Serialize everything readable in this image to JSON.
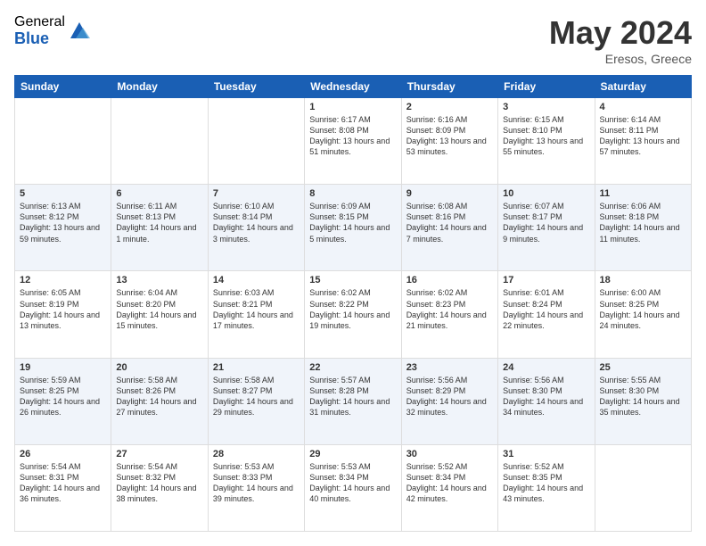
{
  "logo": {
    "general": "General",
    "blue": "Blue"
  },
  "title": "May 2024",
  "location": "Eresos, Greece",
  "headers": [
    "Sunday",
    "Monday",
    "Tuesday",
    "Wednesday",
    "Thursday",
    "Friday",
    "Saturday"
  ],
  "weeks": [
    [
      {
        "day": "",
        "sunrise": "",
        "sunset": "",
        "daylight": ""
      },
      {
        "day": "",
        "sunrise": "",
        "sunset": "",
        "daylight": ""
      },
      {
        "day": "",
        "sunrise": "",
        "sunset": "",
        "daylight": ""
      },
      {
        "day": "1",
        "sunrise": "Sunrise: 6:17 AM",
        "sunset": "Sunset: 8:08 PM",
        "daylight": "Daylight: 13 hours and 51 minutes."
      },
      {
        "day": "2",
        "sunrise": "Sunrise: 6:16 AM",
        "sunset": "Sunset: 8:09 PM",
        "daylight": "Daylight: 13 hours and 53 minutes."
      },
      {
        "day": "3",
        "sunrise": "Sunrise: 6:15 AM",
        "sunset": "Sunset: 8:10 PM",
        "daylight": "Daylight: 13 hours and 55 minutes."
      },
      {
        "day": "4",
        "sunrise": "Sunrise: 6:14 AM",
        "sunset": "Sunset: 8:11 PM",
        "daylight": "Daylight: 13 hours and 57 minutes."
      }
    ],
    [
      {
        "day": "5",
        "sunrise": "Sunrise: 6:13 AM",
        "sunset": "Sunset: 8:12 PM",
        "daylight": "Daylight: 13 hours and 59 minutes."
      },
      {
        "day": "6",
        "sunrise": "Sunrise: 6:11 AM",
        "sunset": "Sunset: 8:13 PM",
        "daylight": "Daylight: 14 hours and 1 minute."
      },
      {
        "day": "7",
        "sunrise": "Sunrise: 6:10 AM",
        "sunset": "Sunset: 8:14 PM",
        "daylight": "Daylight: 14 hours and 3 minutes."
      },
      {
        "day": "8",
        "sunrise": "Sunrise: 6:09 AM",
        "sunset": "Sunset: 8:15 PM",
        "daylight": "Daylight: 14 hours and 5 minutes."
      },
      {
        "day": "9",
        "sunrise": "Sunrise: 6:08 AM",
        "sunset": "Sunset: 8:16 PM",
        "daylight": "Daylight: 14 hours and 7 minutes."
      },
      {
        "day": "10",
        "sunrise": "Sunrise: 6:07 AM",
        "sunset": "Sunset: 8:17 PM",
        "daylight": "Daylight: 14 hours and 9 minutes."
      },
      {
        "day": "11",
        "sunrise": "Sunrise: 6:06 AM",
        "sunset": "Sunset: 8:18 PM",
        "daylight": "Daylight: 14 hours and 11 minutes."
      }
    ],
    [
      {
        "day": "12",
        "sunrise": "Sunrise: 6:05 AM",
        "sunset": "Sunset: 8:19 PM",
        "daylight": "Daylight: 14 hours and 13 minutes."
      },
      {
        "day": "13",
        "sunrise": "Sunrise: 6:04 AM",
        "sunset": "Sunset: 8:20 PM",
        "daylight": "Daylight: 14 hours and 15 minutes."
      },
      {
        "day": "14",
        "sunrise": "Sunrise: 6:03 AM",
        "sunset": "Sunset: 8:21 PM",
        "daylight": "Daylight: 14 hours and 17 minutes."
      },
      {
        "day": "15",
        "sunrise": "Sunrise: 6:02 AM",
        "sunset": "Sunset: 8:22 PM",
        "daylight": "Daylight: 14 hours and 19 minutes."
      },
      {
        "day": "16",
        "sunrise": "Sunrise: 6:02 AM",
        "sunset": "Sunset: 8:23 PM",
        "daylight": "Daylight: 14 hours and 21 minutes."
      },
      {
        "day": "17",
        "sunrise": "Sunrise: 6:01 AM",
        "sunset": "Sunset: 8:24 PM",
        "daylight": "Daylight: 14 hours and 22 minutes."
      },
      {
        "day": "18",
        "sunrise": "Sunrise: 6:00 AM",
        "sunset": "Sunset: 8:25 PM",
        "daylight": "Daylight: 14 hours and 24 minutes."
      }
    ],
    [
      {
        "day": "19",
        "sunrise": "Sunrise: 5:59 AM",
        "sunset": "Sunset: 8:25 PM",
        "daylight": "Daylight: 14 hours and 26 minutes."
      },
      {
        "day": "20",
        "sunrise": "Sunrise: 5:58 AM",
        "sunset": "Sunset: 8:26 PM",
        "daylight": "Daylight: 14 hours and 27 minutes."
      },
      {
        "day": "21",
        "sunrise": "Sunrise: 5:58 AM",
        "sunset": "Sunset: 8:27 PM",
        "daylight": "Daylight: 14 hours and 29 minutes."
      },
      {
        "day": "22",
        "sunrise": "Sunrise: 5:57 AM",
        "sunset": "Sunset: 8:28 PM",
        "daylight": "Daylight: 14 hours and 31 minutes."
      },
      {
        "day": "23",
        "sunrise": "Sunrise: 5:56 AM",
        "sunset": "Sunset: 8:29 PM",
        "daylight": "Daylight: 14 hours and 32 minutes."
      },
      {
        "day": "24",
        "sunrise": "Sunrise: 5:56 AM",
        "sunset": "Sunset: 8:30 PM",
        "daylight": "Daylight: 14 hours and 34 minutes."
      },
      {
        "day": "25",
        "sunrise": "Sunrise: 5:55 AM",
        "sunset": "Sunset: 8:30 PM",
        "daylight": "Daylight: 14 hours and 35 minutes."
      }
    ],
    [
      {
        "day": "26",
        "sunrise": "Sunrise: 5:54 AM",
        "sunset": "Sunset: 8:31 PM",
        "daylight": "Daylight: 14 hours and 36 minutes."
      },
      {
        "day": "27",
        "sunrise": "Sunrise: 5:54 AM",
        "sunset": "Sunset: 8:32 PM",
        "daylight": "Daylight: 14 hours and 38 minutes."
      },
      {
        "day": "28",
        "sunrise": "Sunrise: 5:53 AM",
        "sunset": "Sunset: 8:33 PM",
        "daylight": "Daylight: 14 hours and 39 minutes."
      },
      {
        "day": "29",
        "sunrise": "Sunrise: 5:53 AM",
        "sunset": "Sunset: 8:34 PM",
        "daylight": "Daylight: 14 hours and 40 minutes."
      },
      {
        "day": "30",
        "sunrise": "Sunrise: 5:52 AM",
        "sunset": "Sunset: 8:34 PM",
        "daylight": "Daylight: 14 hours and 42 minutes."
      },
      {
        "day": "31",
        "sunrise": "Sunrise: 5:52 AM",
        "sunset": "Sunset: 8:35 PM",
        "daylight": "Daylight: 14 hours and 43 minutes."
      },
      {
        "day": "",
        "sunrise": "",
        "sunset": "",
        "daylight": ""
      }
    ]
  ]
}
